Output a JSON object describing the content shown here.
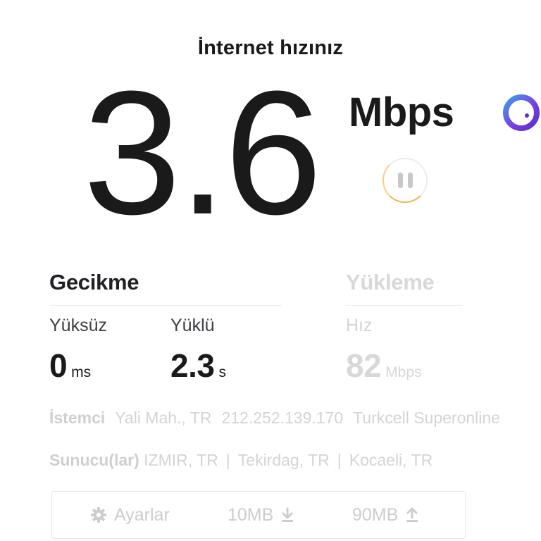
{
  "header": {
    "title": "İnternet hızınız"
  },
  "speed": {
    "value": "3.6",
    "unit": "Mbps"
  },
  "latency": {
    "heading": "Gecikme",
    "unloaded": {
      "label": "Yüksüz",
      "value": "0",
      "unit": "ms"
    },
    "loaded": {
      "label": "Yüklü",
      "value": "2.3",
      "unit": "s"
    }
  },
  "upload": {
    "heading": "Yükleme",
    "speed": {
      "label": "Hız",
      "value": "82",
      "unit": "Mbps"
    }
  },
  "client": {
    "label": "İstemci",
    "location": "Yali Mah., TR",
    "ip": "212.252.139.170",
    "isp": "Turkcell Superonline"
  },
  "servers": {
    "label": "Sunucu(lar)",
    "items": [
      "IZMIR, TR",
      "Tekirdag, TR",
      "Kocaeli, TR"
    ]
  },
  "settings_bar": {
    "settings_label": "Ayarlar",
    "download_size": "10MB",
    "upload_size": "90MB"
  },
  "icons": {
    "pause": "pause-icon",
    "brand": "brand-ring-icon",
    "gear": "gear-icon",
    "download": "download-arrow-icon",
    "upload": "upload-arrow-icon"
  },
  "colors": {
    "text_primary": "#202124",
    "text_muted": "#d4d4d4",
    "progress_ring": "#f1b64a",
    "brand_purple": "#7b3fe4",
    "brand_blue": "#3aa0e8"
  }
}
